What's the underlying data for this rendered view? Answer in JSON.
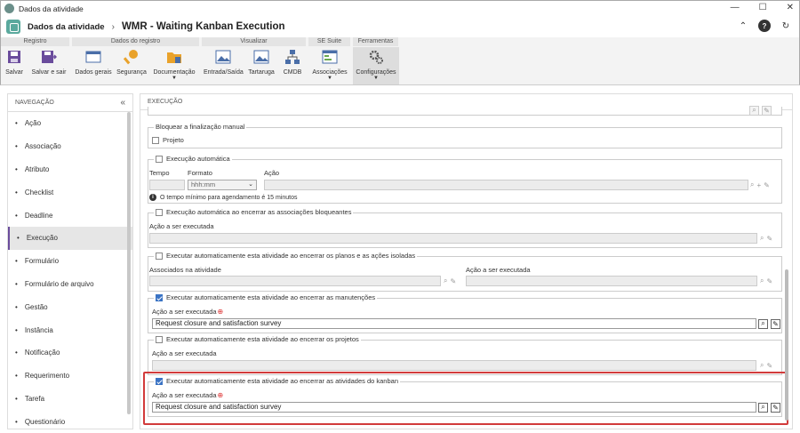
{
  "window": {
    "title": "Dados da atividade"
  },
  "header": {
    "breadcrumb": "Dados da atividade",
    "title": "WMR - Waiting Kanban Execution"
  },
  "ribbon": {
    "groups": [
      "Registro",
      "Dados do registro",
      "Visualizar",
      "SE Suite",
      "Ferramentas"
    ],
    "buttons": {
      "salvar": "Salvar",
      "salvar_sair": "Salvar e sair",
      "dados_gerais": "Dados gerais",
      "seguranca": "Segurança",
      "documentacao": "Documentação",
      "entrada_saida": "Entrada/Saída",
      "tartaruga": "Tartaruga",
      "cmdb": "CMDB",
      "associacoes": "Associações",
      "configuracoes": "Configurações"
    }
  },
  "nav": {
    "header": "NAVEGAÇÃO",
    "items": [
      "Ação",
      "Associação",
      "Atributo",
      "Checklist",
      "Deadline",
      "Execução",
      "Formulário",
      "Formulário de arquivo",
      "Gestão",
      "Instância",
      "Notificação",
      "Requerimento",
      "Tarefa",
      "Questionário"
    ],
    "active": "Execução"
  },
  "main": {
    "header": "EXECUÇÃO",
    "bloquear": {
      "legend": "Bloquear a finalização manual",
      "checkbox": "Projeto"
    },
    "auto": {
      "legend": "Execução automática",
      "tempo": "Tempo",
      "formato": "Formato",
      "formato_value": "hhh:mm",
      "acao": "Ação",
      "info": "O tempo mínimo para agendamento é 15 minutos"
    },
    "bloqueantes": {
      "legend": "Execução automática ao encerrar as associações bloqueantes",
      "acao": "Ação a ser executada"
    },
    "planos": {
      "legend": "Executar automaticamente esta atividade ao encerrar os planos e as ações isoladas",
      "associados": "Associados na atividade",
      "acao": "Ação a ser executada"
    },
    "manutencoes": {
      "legend": "Executar automaticamente esta atividade ao encerrar as manutenções",
      "acao": "Ação a ser executada",
      "value": "Request closure and satisfaction survey"
    },
    "projetos": {
      "legend": "Executar automaticamente esta atividade ao encerrar os projetos",
      "acao": "Ação a ser executada"
    },
    "kanban": {
      "legend": "Executar automaticamente esta atividade ao encerrar as atividades do kanban",
      "acao": "Ação a ser executada",
      "value": "Request closure and satisfaction survey"
    }
  },
  "colors": {
    "accent": "#3a73c4",
    "highlight": "#d23b3b",
    "nav_active": "#6a4c9c"
  }
}
